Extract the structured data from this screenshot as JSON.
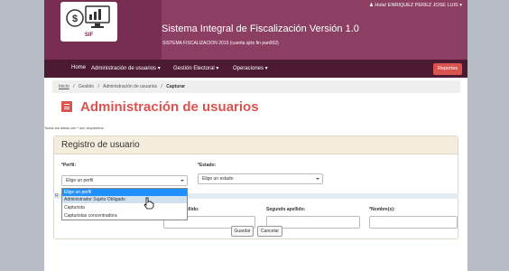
{
  "header": {
    "logo_text": "SIF",
    "title": "Sistema Integral de Fiscalización Versión 1.0",
    "subtitle": "SISTEMA FISCALIZACION 2015 (cuenta sjrto fin pan002)",
    "user": "Hola! ENRIQUEZ PEREZ JOSE LUIS ▾"
  },
  "nav": {
    "home": "Home",
    "admin": "Administración de usuarios ▾",
    "electoral": "Gestión Electoral ▾",
    "operaciones": "Operaciones ▾",
    "reportes": "Reportes"
  },
  "breadcrumb": {
    "inicio": "Inicio",
    "sep": "/",
    "gestion": "Gestión",
    "admin": "Administración de usuarios",
    "current": "Capturar"
  },
  "page": {
    "title": "Administración de usuarios",
    "required_note": "Todos los datos con * son requeridos."
  },
  "form": {
    "panel_title": "Registro de usuario",
    "perfil_label": "*Perfil:",
    "perfil_value": "Elige un perfil",
    "estado_label": "*Estado:",
    "estado_value": "Elige un estado",
    "primer_apellido_label": "*Primer apellido:",
    "segundo_apellido_label": "Segundo apellido:",
    "nombres_label": "*Nombre(s):",
    "strip_char": "R"
  },
  "dropdown": {
    "options": [
      "Elige un perfil",
      "Administrador Sujeto Obligado",
      "Capturista",
      "Capturistas concentradora"
    ],
    "selected_index": 0,
    "hover_index": 1
  },
  "buttons": {
    "guardar": "Guardar",
    "cancelar": "Cancelar"
  },
  "colors": {
    "brand": "#7a2d52",
    "nav": "#4d1a33",
    "accent": "#d9534f",
    "selection": "#1e90ff"
  }
}
